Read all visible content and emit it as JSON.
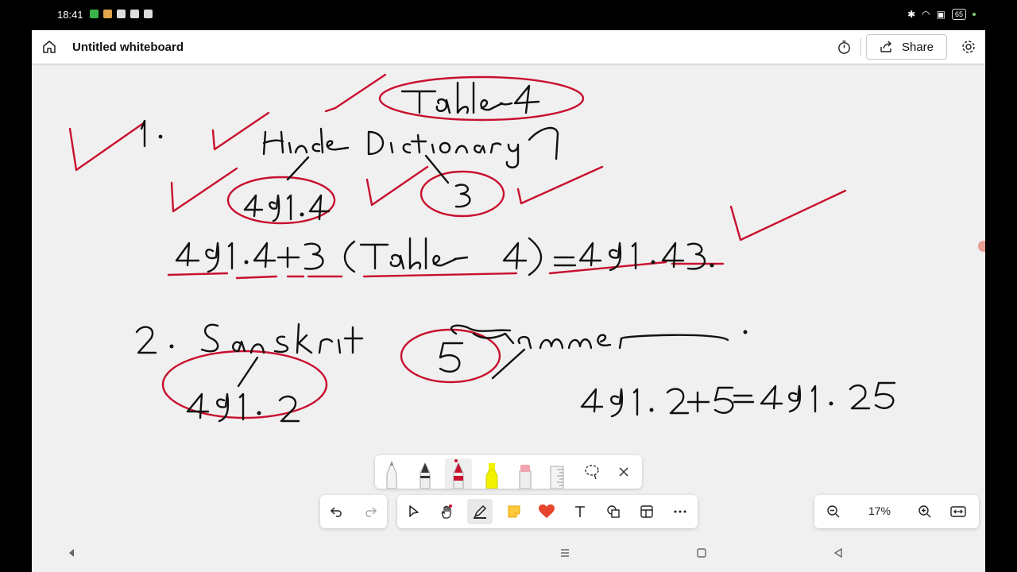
{
  "status_bar": {
    "time": "18:41",
    "battery": "65"
  },
  "app": {
    "title": "Untitled whiteboard",
    "share_label": "Share",
    "zoom_level": "17%"
  },
  "ink": {
    "red": "#c8102e",
    "black": "#111111"
  }
}
